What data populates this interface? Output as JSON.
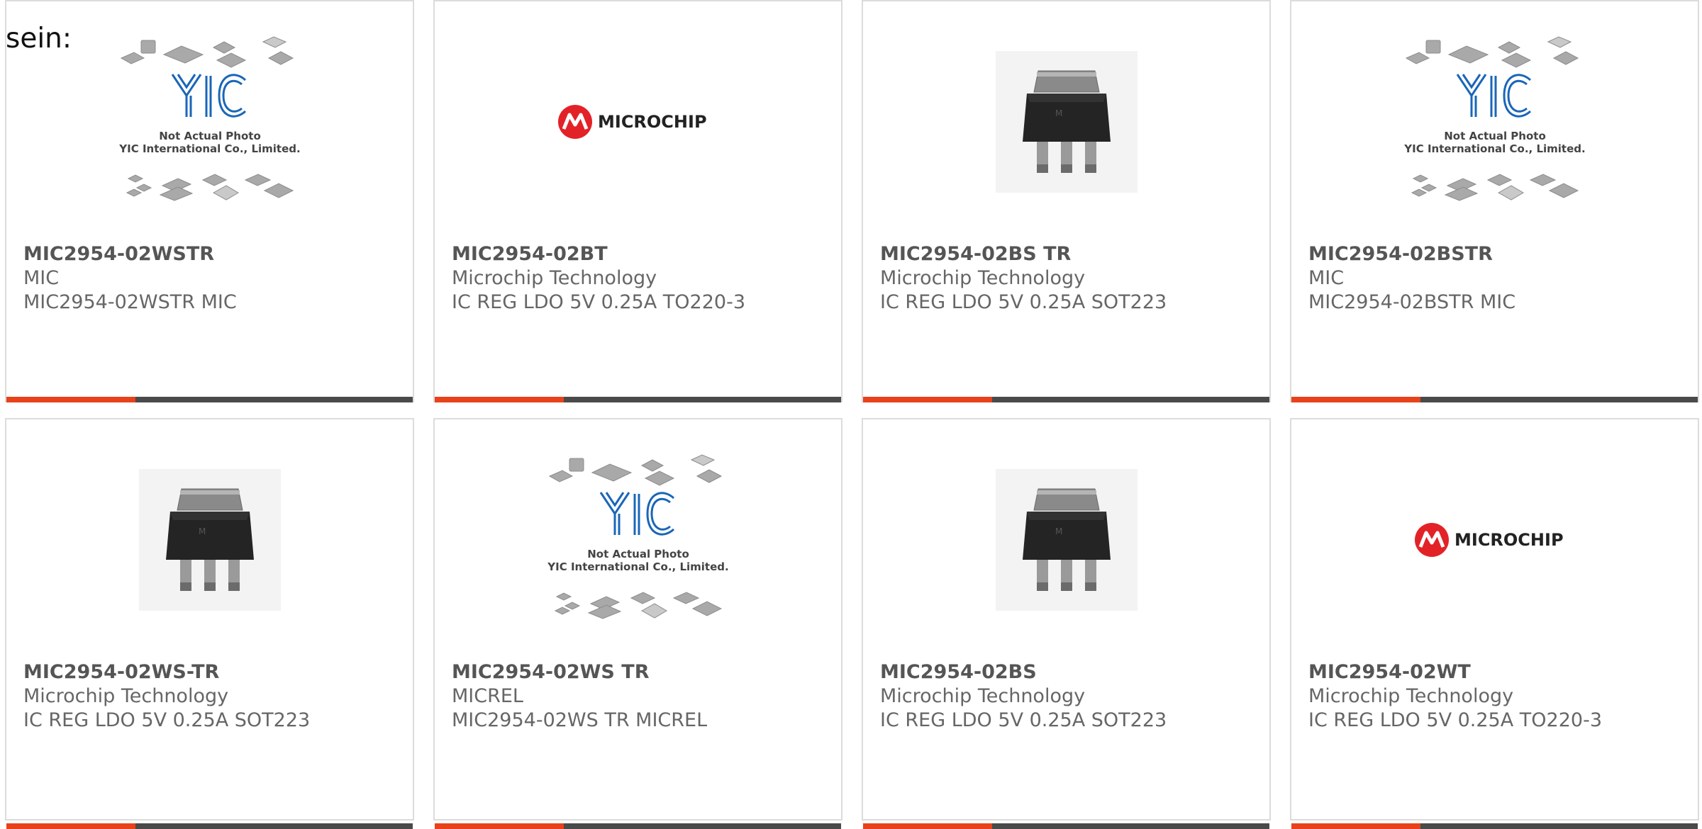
{
  "intro": "sein:",
  "accent_color": "#e8421b",
  "bar_color": "#4a4a4a",
  "placeholder": {
    "line1": "Not Actual Photo",
    "line2": "YIC International Co., Limited.",
    "logo_text": "YIC"
  },
  "microchip_logo_text": "MICROCHIP",
  "products": [
    {
      "part": "MIC2954-02WSTR",
      "manufacturer": "MIC",
      "description": "MIC2954-02WSTR MIC",
      "image": "placeholder"
    },
    {
      "part": "MIC2954-02BT",
      "manufacturer": "Microchip Technology",
      "description": "IC REG LDO 5V 0.25A TO220-3",
      "image": "microchip-logo"
    },
    {
      "part": "MIC2954-02BS TR",
      "manufacturer": "Microchip Technology",
      "description": "IC REG LDO 5V 0.25A SOT223",
      "image": "sot223"
    },
    {
      "part": "MIC2954-02BSTR",
      "manufacturer": "MIC",
      "description": "MIC2954-02BSTR MIC",
      "image": "placeholder"
    },
    {
      "part": "MIC2954-02WS-TR",
      "manufacturer": "Microchip Technology",
      "description": "IC REG LDO 5V 0.25A SOT223",
      "image": "sot223"
    },
    {
      "part": "MIC2954-02WS TR",
      "manufacturer": "MICREL",
      "description": "MIC2954-02WS TR MICREL",
      "image": "placeholder"
    },
    {
      "part": "MIC2954-02BS",
      "manufacturer": "Microchip Technology",
      "description": "IC REG LDO 5V 0.25A SOT223",
      "image": "sot223"
    },
    {
      "part": "MIC2954-02WT",
      "manufacturer": "Microchip Technology",
      "description": "IC REG LDO 5V 0.25A TO220-3",
      "image": "microchip-logo"
    }
  ]
}
